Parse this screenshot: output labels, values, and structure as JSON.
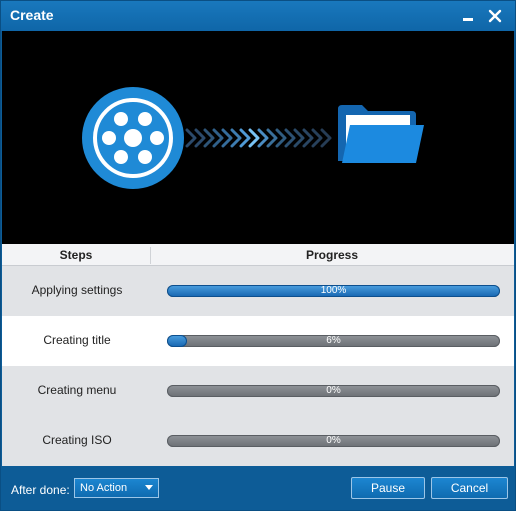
{
  "window": {
    "title": "Create"
  },
  "table": {
    "header_steps": "Steps",
    "header_progress": "Progress",
    "rows": [
      {
        "label": "Applying settings",
        "percent_text": "100%",
        "progress": 1.0
      },
      {
        "label": "Creating title",
        "percent_text": "6%",
        "progress": 0.06
      },
      {
        "label": "Creating menu",
        "percent_text": "0%",
        "progress": 0.0
      },
      {
        "label": "Creating ISO",
        "percent_text": "0%",
        "progress": 0.0
      }
    ]
  },
  "footer": {
    "after_done_label": "After done:",
    "after_done_value": "No Action",
    "pause_label": "Pause",
    "cancel_label": "Cancel"
  },
  "colors": {
    "accent": "#0d5c97",
    "progress_fill": "#1f7fcf",
    "progress_track": "#6b6f74",
    "banner": "#000000"
  },
  "icons": {
    "source": "film-reel-icon",
    "target": "folder-icon",
    "transfer": "chevron-arrows-icon"
  }
}
